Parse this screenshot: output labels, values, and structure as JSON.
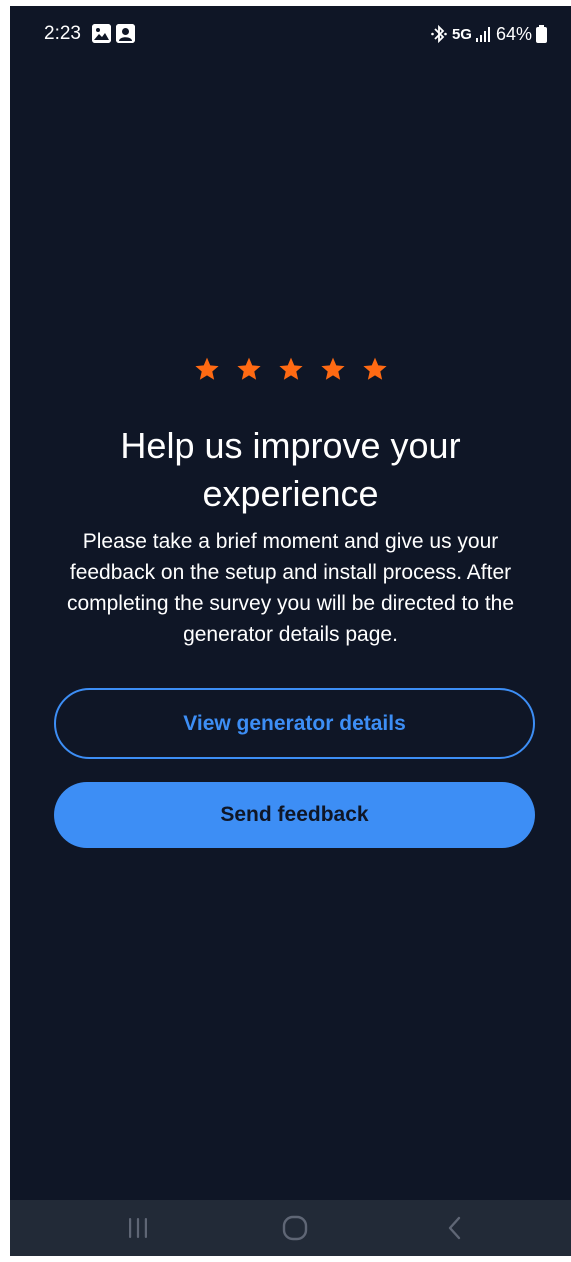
{
  "status_bar": {
    "time": "2:23",
    "network": "5G",
    "battery": "64%",
    "icons": [
      "gallery-icon",
      "contact-icon",
      "bluetooth-icon",
      "signal-icon",
      "battery-icon"
    ]
  },
  "rating": {
    "stars_shown": 5,
    "star_color": "#ff6a13"
  },
  "dialog": {
    "title": "Help us improve your experience",
    "body": "Please take a brief moment and give us your feedback on the setup and install process. After completing the survey you will be directed to the generator details page.",
    "view_details_label": "View generator details",
    "send_feedback_label": "Send feedback"
  },
  "colors": {
    "background": "#0f1626",
    "accent": "#3d8ef5",
    "nav_bar": "#222a37"
  },
  "nav_bar": {
    "icons": [
      "recents-icon",
      "home-icon",
      "back-icon"
    ]
  }
}
